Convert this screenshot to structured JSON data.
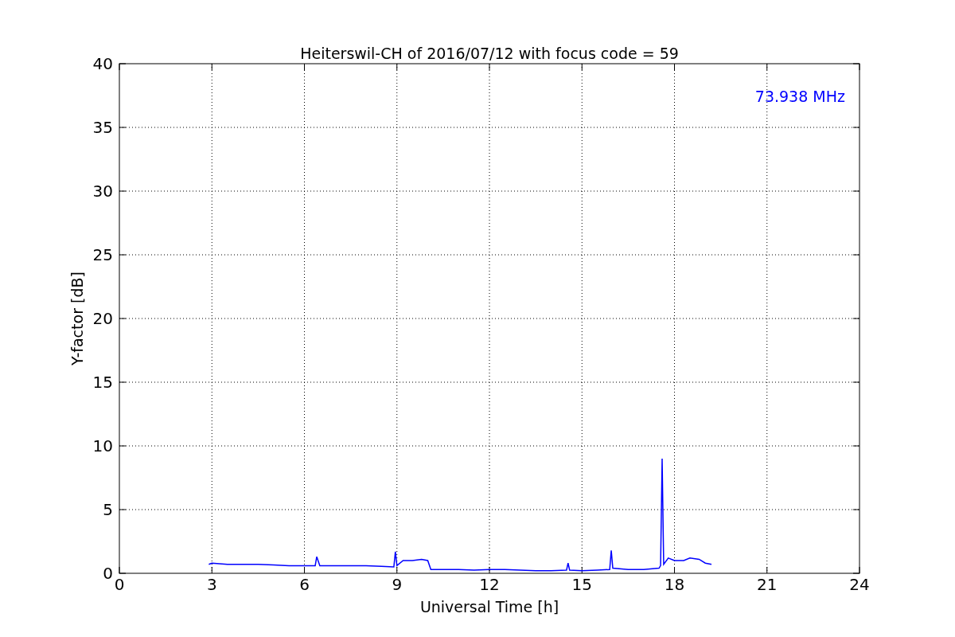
{
  "chart_data": {
    "type": "line",
    "title": "Heiterswil-CH of 2016/07/12 with focus code = 59",
    "xlabel": "Universal Time [h]",
    "ylabel": "Y-factor [dB]",
    "x": [
      2.9,
      3.0,
      3.5,
      4,
      4.5,
      5,
      5.5,
      6,
      6.35,
      6.4,
      6.5,
      7,
      7.5,
      8,
      8.5,
      8.9,
      8.95,
      9.0,
      9.2,
      9.5,
      9.8,
      10.0,
      10.1,
      10.5,
      11,
      11.5,
      12,
      12.5,
      13,
      13.5,
      14,
      14.5,
      14.55,
      14.6,
      15,
      15.5,
      15.9,
      15.95,
      16.0,
      16.5,
      17,
      17.5,
      17.55,
      17.6,
      17.65,
      17.8,
      18,
      18.3,
      18.5,
      18.8,
      19,
      19.2
    ],
    "series": [
      {
        "name": "73.938 MHz",
        "color": "#0000ff",
        "values": [
          0.7,
          0.8,
          0.7,
          0.7,
          0.7,
          0.65,
          0.6,
          0.6,
          0.6,
          1.3,
          0.6,
          0.6,
          0.6,
          0.6,
          0.55,
          0.5,
          1.7,
          0.6,
          1.0,
          1.0,
          1.1,
          1.0,
          0.3,
          0.3,
          0.3,
          0.25,
          0.3,
          0.3,
          0.25,
          0.2,
          0.2,
          0.25,
          0.8,
          0.25,
          0.2,
          0.25,
          0.3,
          1.8,
          0.4,
          0.3,
          0.3,
          0.4,
          0.6,
          9.0,
          0.7,
          1.2,
          1.0,
          1.0,
          1.2,
          1.1,
          0.8,
          0.7
        ]
      }
    ],
    "xlim": [
      0,
      24
    ],
    "ylim": [
      0,
      40
    ],
    "xticks": [
      0,
      3,
      6,
      9,
      12,
      15,
      18,
      21,
      24
    ],
    "yticks": [
      0,
      5,
      10,
      15,
      20,
      25,
      30,
      35,
      40
    ],
    "grid": true
  }
}
